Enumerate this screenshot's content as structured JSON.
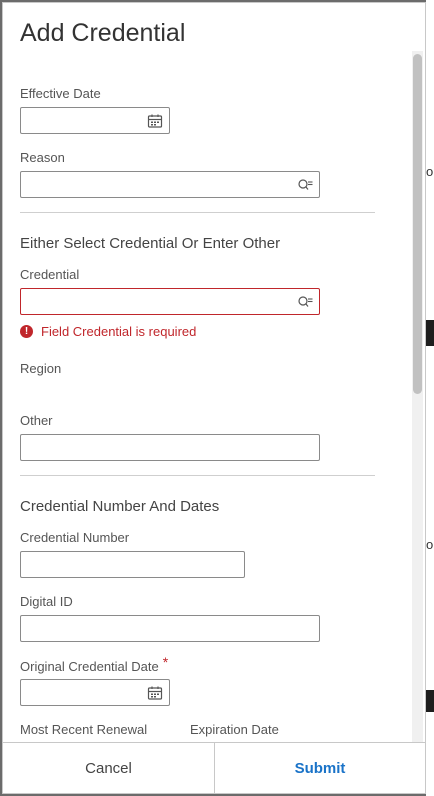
{
  "dialog": {
    "title": "Add Credential",
    "fields": {
      "effective_date_label": "Effective Date",
      "reason_label": "Reason",
      "section_credential": "Either Select Credential Or Enter Other",
      "credential_label": "Credential",
      "credential_error": "Field Credential is required",
      "region_label": "Region",
      "other_label": "Other",
      "section_number": "Credential Number And Dates",
      "credential_number_label": "Credential Number",
      "digital_id_label": "Digital ID",
      "original_date_label": "Original Credential Date",
      "required_marker": "*",
      "recent_renewal_label": "Most Recent Renewal",
      "expiration_date_label": "Expiration Date"
    },
    "footer": {
      "cancel_label": "Cancel",
      "submit_label": "Submit"
    }
  },
  "background": {
    "glyphs": [
      "o",
      "o"
    ]
  },
  "colors": {
    "error": "#c0262b",
    "accent": "#1a73c8"
  },
  "icons": {
    "calendar": "calendar-icon",
    "lookup": "lookup-search-icon",
    "error": "error-icon"
  }
}
